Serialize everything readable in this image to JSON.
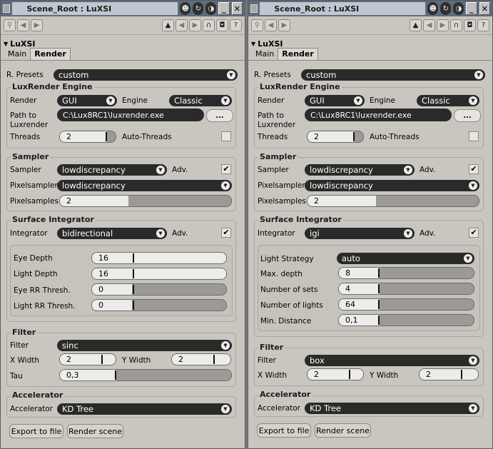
{
  "panels": [
    {
      "title": "Scene_Root : LuXSI",
      "section": "LuXSI",
      "tabs": [
        "Main",
        "Render"
      ],
      "presets_label": "R. Presets",
      "presets_value": "custom",
      "engine": {
        "title": "LuxRender Engine",
        "render_label": "Render",
        "render_value": "GUI",
        "engine_label": "Engine",
        "engine_value": "Classic",
        "path_label_1": "Path to",
        "path_label_2": "Luxrender",
        "path_value": "C:\\Lux8RC1\\luxrender.exe",
        "ellipsis": "...",
        "threads_label": "Threads",
        "threads_value": "2",
        "threads_fill": 0.85,
        "autothreads_label": "Auto-Threads"
      },
      "sampler": {
        "title": "Sampler",
        "sampler_label": "Sampler",
        "sampler_value": "lowdiscrepancy",
        "adv_label": "Adv.",
        "adv_checked": "✔",
        "pixelsampler_label": "Pixelsampler",
        "pixelsampler_value": "lowdiscrepancy",
        "pixelsamples_label": "Pixelsamples",
        "pixelsamples_value": "2",
        "pixelsamples_fill": 0.4
      },
      "integrator": {
        "title": "Surface Integrator",
        "integrator_label": "Integrator",
        "integrator_value": "bidirectional",
        "adv_label": "Adv.",
        "adv_checked": "✔",
        "params": [
          {
            "label": "Eye Depth",
            "value": "16",
            "fill": 1.0
          },
          {
            "label": "Light Depth",
            "value": "16",
            "fill": 1.0
          },
          {
            "label": "Eye RR Thresh.",
            "value": "0",
            "fill": 0.3
          },
          {
            "label": "Light RR Thresh.",
            "value": "0",
            "fill": 0.3
          }
        ]
      },
      "filter": {
        "title": "Filter",
        "filter_label": "Filter",
        "filter_value": "sinc",
        "xwidth_label": "X Width",
        "xwidth_value": "2",
        "ywidth_label": "Y Width",
        "ywidth_value": "2",
        "tau_label": "Tau",
        "tau_value": "0,3",
        "tau_fill": 0.33
      },
      "accel": {
        "title": "Accelerator",
        "accel_label": "Accelerator",
        "accel_value": "KD Tree"
      },
      "buttons": {
        "export": "Export to file",
        "render": "Render scene"
      }
    },
    {
      "title": "Scene_Root : LuXSI",
      "section": "LuXSI",
      "tabs": [
        "Main",
        "Render"
      ],
      "presets_label": "R. Presets",
      "presets_value": "custom",
      "engine": {
        "title": "LuxRender Engine",
        "render_label": "Render",
        "render_value": "GUI",
        "engine_label": "Engine",
        "engine_value": "Classic",
        "path_label_1": "Path to",
        "path_label_2": "Luxrender",
        "path_value": "C:\\Lux8RC1\\luxrender.exe",
        "ellipsis": "...",
        "threads_label": "Threads",
        "threads_value": "2",
        "threads_fill": 0.85,
        "autothreads_label": "Auto-Threads"
      },
      "sampler": {
        "title": "Sampler",
        "sampler_label": "Sampler",
        "sampler_value": "lowdiscrepancy",
        "adv_label": "Adv.",
        "adv_checked": "✔",
        "pixelsampler_label": "Pixelsampler",
        "pixelsampler_value": "lowdiscrepancy",
        "pixelsamples_label": "Pixelsamples",
        "pixelsamples_value": "2",
        "pixelsamples_fill": 0.4
      },
      "integrator": {
        "title": "Surface Integrator",
        "integrator_label": "Integrator",
        "integrator_value": "igi",
        "adv_label": "Adv.",
        "adv_checked": "✔",
        "strategy_label": "Light Strategy",
        "strategy_value": "auto",
        "params": [
          {
            "label": "Max. depth",
            "value": "8",
            "fill": 0.3
          },
          {
            "label": "Number of sets",
            "value": "4",
            "fill": 0.3
          },
          {
            "label": "Number of lights",
            "value": "64",
            "fill": 0.3
          },
          {
            "label": "Min. Distance",
            "value": "0,1",
            "fill": 0.3
          }
        ]
      },
      "filter": {
        "title": "Filter",
        "filter_label": "Filter",
        "filter_value": "box",
        "xwidth_label": "X Width",
        "xwidth_value": "2",
        "ywidth_label": "Y Width",
        "ywidth_value": "2"
      },
      "accel": {
        "title": "Accelerator",
        "accel_label": "Accelerator",
        "accel_value": "KD Tree"
      },
      "buttons": {
        "export": "Export to file",
        "render": "Render scene"
      }
    }
  ]
}
